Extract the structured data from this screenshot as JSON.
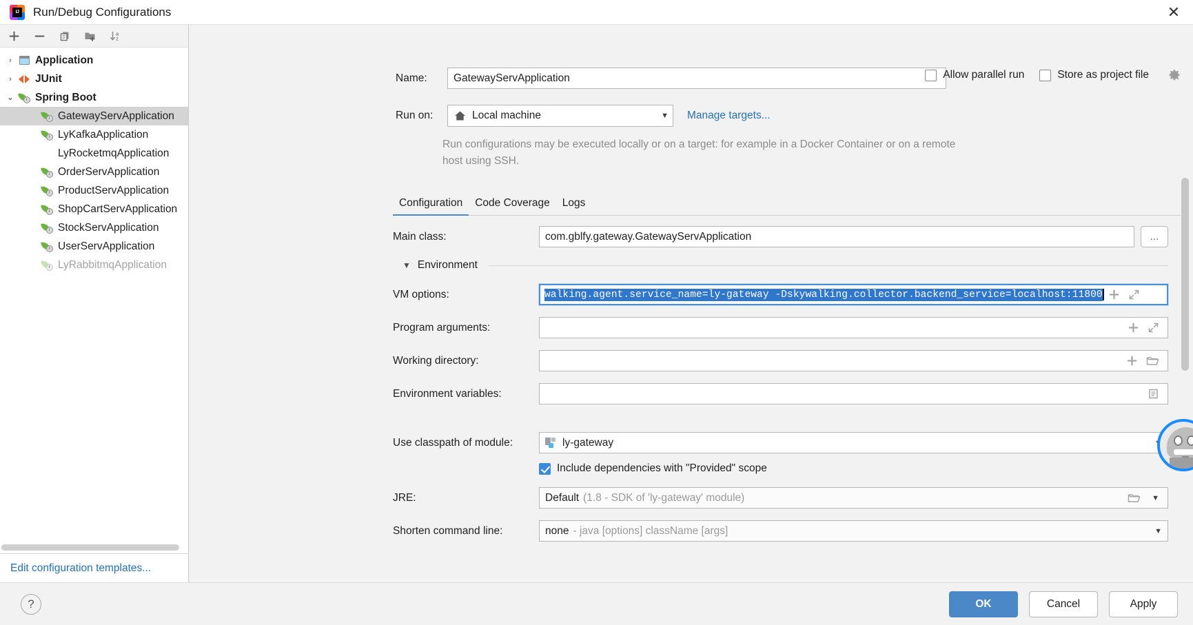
{
  "window": {
    "title": "Run/Debug Configurations",
    "logo_text": "IJ",
    "close_label": "✕"
  },
  "toolbar": {
    "add": "+",
    "remove": "−",
    "copy": "copy-icon",
    "folder": "new-folder-icon",
    "sort": "sort-alphabetically-icon"
  },
  "tree": {
    "groups": [
      {
        "label": "Application",
        "twisty": "›",
        "icon": "application-icon"
      },
      {
        "label": "JUnit",
        "twisty": "›",
        "icon": "junit-icon"
      },
      {
        "label": "Spring Boot",
        "twisty": "⌄",
        "icon": "spring-boot-icon"
      }
    ],
    "items": [
      {
        "label": "GatewayServApplication",
        "selected": true,
        "icon": "spring-boot-icon",
        "disabled": false
      },
      {
        "label": "LyKafkaApplication",
        "selected": false,
        "icon": "spring-boot-icon",
        "disabled": false
      },
      {
        "label": "LyRocketmqApplication",
        "selected": false,
        "icon": "none",
        "disabled": false
      },
      {
        "label": "OrderServApplication",
        "selected": false,
        "icon": "spring-boot-icon",
        "disabled": false
      },
      {
        "label": "ProductServApplication",
        "selected": false,
        "icon": "spring-boot-icon",
        "disabled": false
      },
      {
        "label": "ShopCartServApplication",
        "selected": false,
        "icon": "spring-boot-icon",
        "disabled": false
      },
      {
        "label": "StockServApplication",
        "selected": false,
        "icon": "spring-boot-icon",
        "disabled": false
      },
      {
        "label": "UserServApplication",
        "selected": false,
        "icon": "spring-boot-icon",
        "disabled": false
      },
      {
        "label": "LyRabbitmqApplication",
        "selected": false,
        "icon": "spring-boot-icon",
        "disabled": true
      }
    ],
    "footer_link": "Edit configuration templates..."
  },
  "form": {
    "name_label": "Name:",
    "name_value": "GatewayServApplication",
    "allow_parallel_run": "Allow parallel run",
    "allow_parallel_run_checked": false,
    "store_as_project_file": "Store as project file",
    "store_as_project_file_checked": false,
    "run_on_label": "Run on:",
    "run_on_value": "Local machine",
    "manage_targets_link": "Manage targets...",
    "hint": "Run configurations may be executed locally or on a target: for example in a Docker Container or on a remote host using SSH.",
    "main_class_label": "Main class:",
    "main_class_value": "com.gblfy.gateway.GatewayServApplication",
    "browse_label": "...",
    "environment_label": "Environment",
    "vm_options_label": "VM options:",
    "vm_options_value": "walking.agent.service_name=ly-gateway  -Dskywalking.collector.backend_service=localhost:11800",
    "program_arguments_label": "Program arguments:",
    "program_arguments_value": "",
    "working_directory_label": "Working directory:",
    "working_directory_value": "",
    "environment_variables_label": "Environment variables:",
    "environment_variables_value": "",
    "use_classpath_label": "Use classpath of module:",
    "use_classpath_value": "ly-gateway",
    "include_dependencies_label": "Include dependencies with \"Provided\" scope",
    "include_dependencies_checked": true,
    "jre_label": "JRE:",
    "jre_value": "Default",
    "jre_hint": "(1.8 - SDK of 'ly-gateway' module)",
    "shorten_label": "Shorten command line:",
    "shorten_value": "none",
    "shorten_hint": "- java [options] className [args]"
  },
  "tabs": [
    {
      "label": "Configuration",
      "active": true
    },
    {
      "label": "Code Coverage",
      "active": false
    },
    {
      "label": "Logs",
      "active": false
    }
  ],
  "bottom": {
    "help": "?",
    "ok": "OK",
    "cancel": "Cancel",
    "apply": "Apply"
  },
  "colors": {
    "accent": "#4a88c7",
    "link": "#2470b3",
    "selection": "#2f76cd",
    "spring_green": "#6db33f"
  }
}
